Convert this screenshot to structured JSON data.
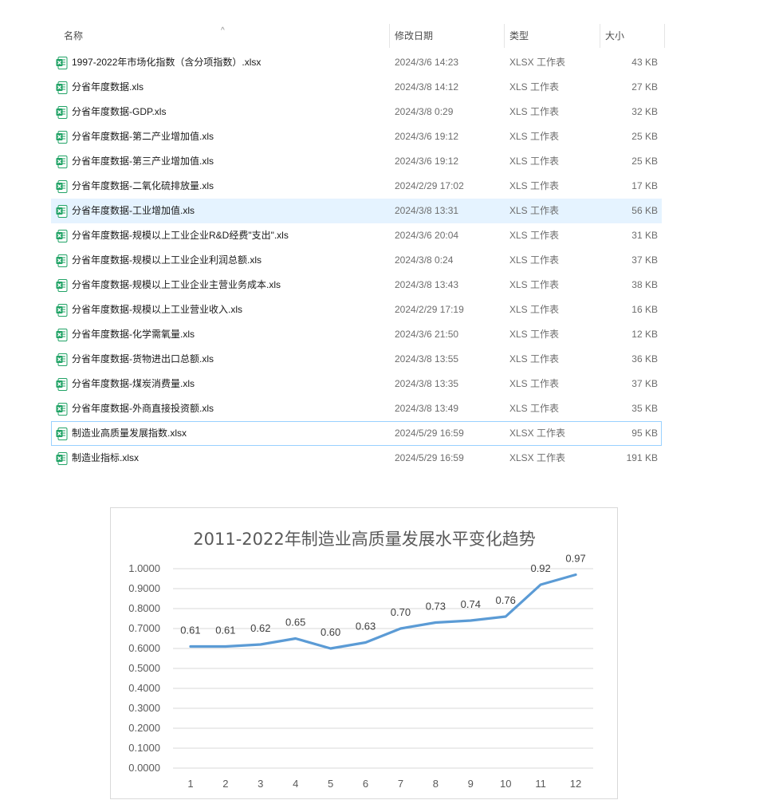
{
  "explorer": {
    "columns": {
      "name": "名称",
      "modified": "修改日期",
      "type": "类型",
      "size": "大小"
    },
    "sort_glyph": "^",
    "files": [
      {
        "name": "1997-2022年市场化指数（含分项指数）.xlsx",
        "modified": "2024/3/6 14:23",
        "type": "XLSX 工作表",
        "size": "43 KB"
      },
      {
        "name": "分省年度数据.xls",
        "modified": "2024/3/8 14:12",
        "type": "XLS 工作表",
        "size": "27 KB"
      },
      {
        "name": "分省年度数据-GDP.xls",
        "modified": "2024/3/8 0:29",
        "type": "XLS 工作表",
        "size": "32 KB"
      },
      {
        "name": "分省年度数据-第二产业增加值.xls",
        "modified": "2024/3/6 19:12",
        "type": "XLS 工作表",
        "size": "25 KB"
      },
      {
        "name": "分省年度数据-第三产业增加值.xls",
        "modified": "2024/3/6 19:12",
        "type": "XLS 工作表",
        "size": "25 KB"
      },
      {
        "name": "分省年度数据-二氧化硫排放量.xls",
        "modified": "2024/2/29 17:02",
        "type": "XLS 工作表",
        "size": "17 KB"
      },
      {
        "name": "分省年度数据-工业增加值.xls",
        "modified": "2024/3/8 13:31",
        "type": "XLS 工作表",
        "size": "56 KB"
      },
      {
        "name": "分省年度数据-规模以上工业企业R&D经费\"支出\".xls",
        "modified": "2024/3/6 20:04",
        "type": "XLS 工作表",
        "size": "31 KB"
      },
      {
        "name": "分省年度数据-规模以上工业企业利润总额.xls",
        "modified": "2024/3/8 0:24",
        "type": "XLS 工作表",
        "size": "37 KB"
      },
      {
        "name": "分省年度数据-规模以上工业企业主营业务成本.xls",
        "modified": "2024/3/8 13:43",
        "type": "XLS 工作表",
        "size": "38 KB"
      },
      {
        "name": "分省年度数据-规模以上工业营业收入.xls",
        "modified": "2024/2/29 17:19",
        "type": "XLS 工作表",
        "size": "16 KB"
      },
      {
        "name": "分省年度数据-化学需氧量.xls",
        "modified": "2024/3/6 21:50",
        "type": "XLS 工作表",
        "size": "12 KB"
      },
      {
        "name": "分省年度数据-货物进出口总额.xls",
        "modified": "2024/3/8 13:55",
        "type": "XLS 工作表",
        "size": "36 KB"
      },
      {
        "name": "分省年度数据-煤炭消费量.xls",
        "modified": "2024/3/8 13:35",
        "type": "XLS 工作表",
        "size": "37 KB"
      },
      {
        "name": "分省年度数据-外商直接投资额.xls",
        "modified": "2024/3/8 13:49",
        "type": "XLS 工作表",
        "size": "35 KB"
      },
      {
        "name": "制造业高质量发展指数.xlsx",
        "modified": "2024/5/29 16:59",
        "type": "XLSX 工作表",
        "size": "95 KB"
      },
      {
        "name": "制造业指标.xlsx",
        "modified": "2024/5/29 16:59",
        "type": "XLSX 工作表",
        "size": "191 KB"
      }
    ],
    "selected_index": 6,
    "focused_index": 15,
    "colors": {
      "selected_bg": "#e5f3ff",
      "focus_border": "#99d1ff",
      "excel_green": "#21a366"
    },
    "file_icon": "excel-file-icon"
  },
  "chart_data": {
    "type": "line",
    "title": "2011-2022年制造业高质量发展水平变化趋势",
    "categories": [
      "1",
      "2",
      "3",
      "4",
      "5",
      "6",
      "7",
      "8",
      "9",
      "10",
      "11",
      "12"
    ],
    "values": [
      0.61,
      0.61,
      0.62,
      0.65,
      0.6,
      0.63,
      0.7,
      0.73,
      0.74,
      0.76,
      0.92,
      0.97
    ],
    "data_labels": [
      "0.61",
      "0.61",
      "0.62",
      "0.65",
      "0.60",
      "0.63",
      "0.70",
      "0.73",
      "0.74",
      "0.76",
      "0.92",
      "0.97"
    ],
    "y_ticks": [
      "0.0000",
      "0.1000",
      "0.2000",
      "0.3000",
      "0.4000",
      "0.5000",
      "0.6000",
      "0.7000",
      "0.8000",
      "0.9000",
      "1.0000"
    ],
    "ylim": [
      0,
      1
    ],
    "grid": true,
    "legend": "none",
    "line_color": "#5b9bd5"
  }
}
